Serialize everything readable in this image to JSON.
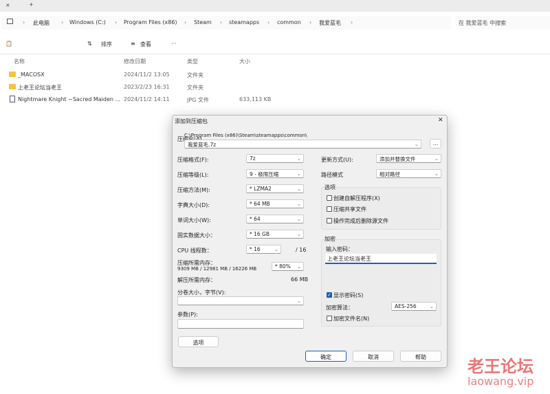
{
  "tabs": {
    "close": "×",
    "new": "+"
  },
  "breadcrumb": [
    "此电脑",
    "Windows (C:)",
    "Program Files (x86)",
    "Steam",
    "steamapps",
    "common",
    "我爱蓝毛"
  ],
  "search_placeholder": "在 我爱蓝毛 中搜索",
  "toolbar": {
    "sort": "排序",
    "view": "查看",
    "more": "···"
  },
  "columns": {
    "name": "名称",
    "date": "修改日期",
    "type": "类型",
    "size": "大小"
  },
  "files": [
    {
      "name": "_MACOSX",
      "date": "2024/11/2 13:05",
      "type": "文件夹",
      "size": "",
      "icon": "folder"
    },
    {
      "name": "上老王论坛当老王",
      "date": "2023/2/23 16:31",
      "type": "文件夹",
      "size": "",
      "icon": "folder"
    },
    {
      "name": "Nightmare Knight ~Sacred Maiden ...",
      "date": "2024/11/2 14:11",
      "type": "JPG 文件",
      "size": "633,113 KB",
      "icon": "image-file"
    }
  ],
  "dialog": {
    "title": "添加到压缩包",
    "close": "✕",
    "archive_label": "压缩包(A)",
    "archive_dir": "C:\\Program Files (x86)\\Steam\\steamapps\\common\\",
    "archive_name": "我爱蓝毛.7z",
    "browse": "...",
    "format_label": "压缩格式(F):",
    "format": "7z",
    "level_label": "压缩等级(L):",
    "level": "9 - 极限压缩",
    "method_label": "压缩方法(M):",
    "method": "* LZMA2",
    "dict_label": "字典大小(D):",
    "dict": "* 64 MB",
    "word_label": "单词大小(W):",
    "word": "* 64",
    "solid_label": "固实数据大小：",
    "solid": "* 16 GB",
    "cpu_label": "CPU 线程数：",
    "cpu": "* 16",
    "cpu_max": "/ 16",
    "mem_label": "压缩所需内存：",
    "mem_values": "9309 MB / 12981 MB / 16226 MB",
    "mem_pct": "* 80%",
    "decomp_label": "解压所需内存：",
    "decomp": "66 MB",
    "split_label": "分卷大小，字节(V):",
    "split": "",
    "params_label": "参数(P):",
    "params": "",
    "options_btn": "选项",
    "update_label": "更新方式(U):",
    "update": "添加并替换文件",
    "path_label": "路径模式",
    "path": "相对路径",
    "options_group": "选项",
    "opt_sfx": "创建自解压程序(X)",
    "opt_shared": "压缩共享文件",
    "opt_delete": "操作完成后删除源文件",
    "enc_group": "加密",
    "pwd_label": "输入密码：",
    "pwd": "上老王论坛当老王",
    "show_pwd": "显示密码(S)",
    "show_pwd_checked": true,
    "enc_method_label": "加密算法：",
    "enc_method": "AES-256",
    "enc_names": "加密文件名(N)",
    "ok": "确定",
    "cancel": "取消",
    "help": "帮助"
  },
  "watermark": {
    "text": "老王论坛",
    "url": "laowang.vip"
  }
}
